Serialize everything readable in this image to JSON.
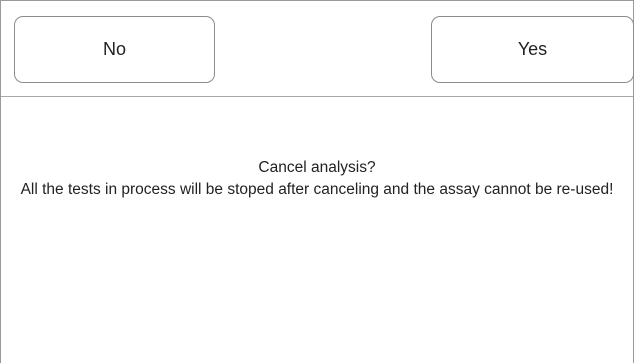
{
  "dialog": {
    "buttons": {
      "no_label": "No",
      "yes_label": "Yes"
    },
    "message": {
      "title": "Cancel analysis?",
      "detail": "All the tests in process will be stoped after canceling and the assay cannot be re-used!"
    }
  }
}
